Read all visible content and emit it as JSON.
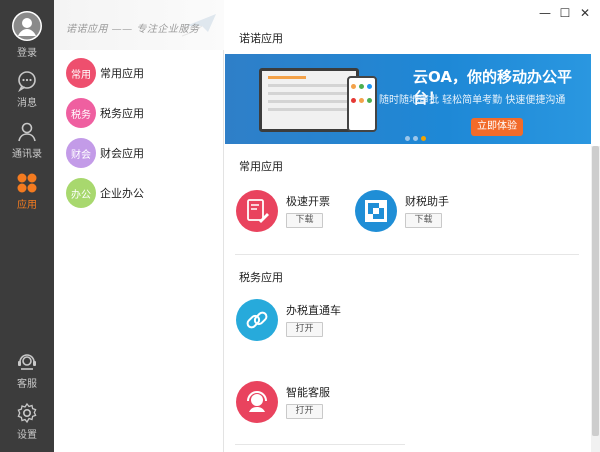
{
  "rail": {
    "items": [
      {
        "label": "登录",
        "icon": "avatar-icon"
      },
      {
        "label": "消息",
        "icon": "message-icon"
      },
      {
        "label": "通讯录",
        "icon": "contacts-icon"
      },
      {
        "label": "应用",
        "icon": "apps-icon"
      },
      {
        "label": "客服",
        "icon": "support-icon"
      },
      {
        "label": "设置",
        "icon": "settings-icon"
      }
    ],
    "active_color": "#f47b20"
  },
  "sidebar": {
    "slogan": "诺诺应用 —— 专注企业服务",
    "categories": [
      {
        "badge": "常用",
        "label": "常用应用",
        "color": "#ee4f6e"
      },
      {
        "badge": "税务",
        "label": "税务应用",
        "color": "#ef5fa0"
      },
      {
        "badge": "财会",
        "label": "财会应用",
        "color": "#c39be8"
      },
      {
        "badge": "办公",
        "label": "企业办公",
        "color": "#a8d86e"
      }
    ]
  },
  "window": {
    "minimize": "—",
    "maximize": "☐",
    "close": "✕"
  },
  "main": {
    "title": "诺诺应用",
    "banner": {
      "headline": "云OA，你的移动办公平台！",
      "subline": "随时随地审批 轻松简单考勤 快速便捷沟通",
      "cta": "立即体验"
    },
    "sections": [
      {
        "title": "常用应用",
        "apps": [
          {
            "name": "极速开票",
            "action": "下载",
            "icon": "invoice-rocket-icon",
            "color": "#e9435e"
          },
          {
            "name": "财税助手",
            "action": "下载",
            "icon": "tax-assistant-icon",
            "color": "#1f8ed6"
          }
        ]
      },
      {
        "title": "税务应用",
        "apps": [
          {
            "name": "办税直通车",
            "action": "打开",
            "icon": "link-chain-icon",
            "color": "#27aadb"
          },
          {
            "name": "智能客服",
            "action": "打开",
            "icon": "smart-service-icon",
            "color": "#e9435e"
          }
        ]
      }
    ]
  }
}
